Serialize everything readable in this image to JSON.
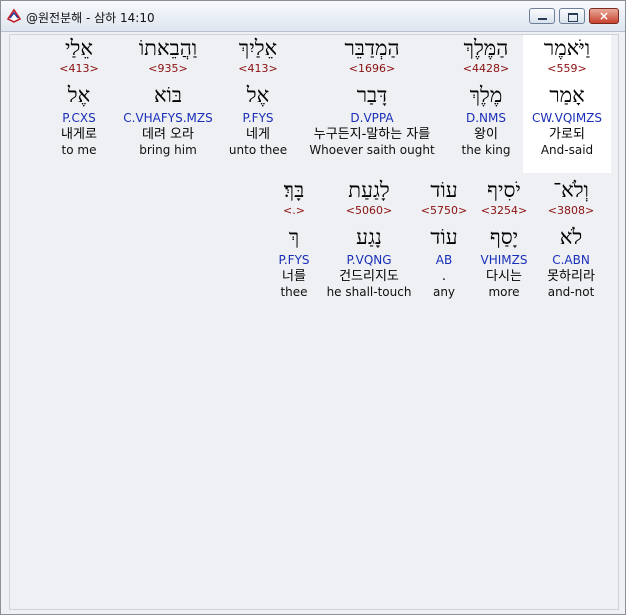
{
  "window": {
    "title": "@원전분해 - 삼하 14:10",
    "close_glyph": "×"
  },
  "words": [
    {
      "hebrew": "וַיֹּאמֶר",
      "strong": "<559>",
      "root": "אָמַר",
      "parse": "CW.VQIMZS",
      "korean": "가로되",
      "english": "And-said"
    },
    {
      "hebrew": "הַמֶּלֶךְ",
      "strong": "<4428>",
      "root": "מֶלֶךְ",
      "parse": "D.NMS",
      "korean": "왕이",
      "english": "the king"
    },
    {
      "hebrew": "הַמְדַבֵּר",
      "strong": "<1696>",
      "root": "דָּבַר",
      "parse": "D.VPPA",
      "korean": "누구든지-말하는 자를",
      "english": "Whoever saith ought"
    },
    {
      "hebrew": "אֵלַיִךְ",
      "strong": "<413>",
      "root": "אֶל",
      "parse": "P.FYS",
      "korean": "네게",
      "english": "unto thee"
    },
    {
      "hebrew": "וַהֲבֵאתוֹ",
      "strong": "<935>",
      "root": "בּוֹא",
      "parse": "C.VHAFYS.MZS",
      "korean": "데려 오라",
      "english": "bring him"
    },
    {
      "hebrew": "אֵלַי",
      "strong": "<413>",
      "root": "אֶל",
      "parse": "P.CXS",
      "korean": "내게로",
      "english": "to me"
    },
    {
      "hebrew": "וְלֹא־",
      "strong": "<3808>",
      "root": "לֹא",
      "parse": "C.ABN",
      "korean": "못하리라",
      "english": "and-not"
    },
    {
      "hebrew": "יֹסִיף",
      "strong": "<3254>",
      "root": "יָסַף",
      "parse": "VHIMZS",
      "korean": "다시는",
      "english": "more"
    },
    {
      "hebrew": "עוֹד",
      "strong": "<5750>",
      "root": "עוֹד",
      "parse": "AB",
      "korean": ".",
      "english": "any"
    },
    {
      "hebrew": "לָגַעַת",
      "strong": "<5060>",
      "root": "נָגַע",
      "parse": "P.VQNG",
      "korean": "건드리지도",
      "english": "he shall-touch"
    },
    {
      "hebrew": "בָּךְ׃",
      "strong": "<.>",
      "root": "ךְ",
      "parse": "P.FYS",
      "korean": "너를",
      "english": "thee"
    }
  ]
}
